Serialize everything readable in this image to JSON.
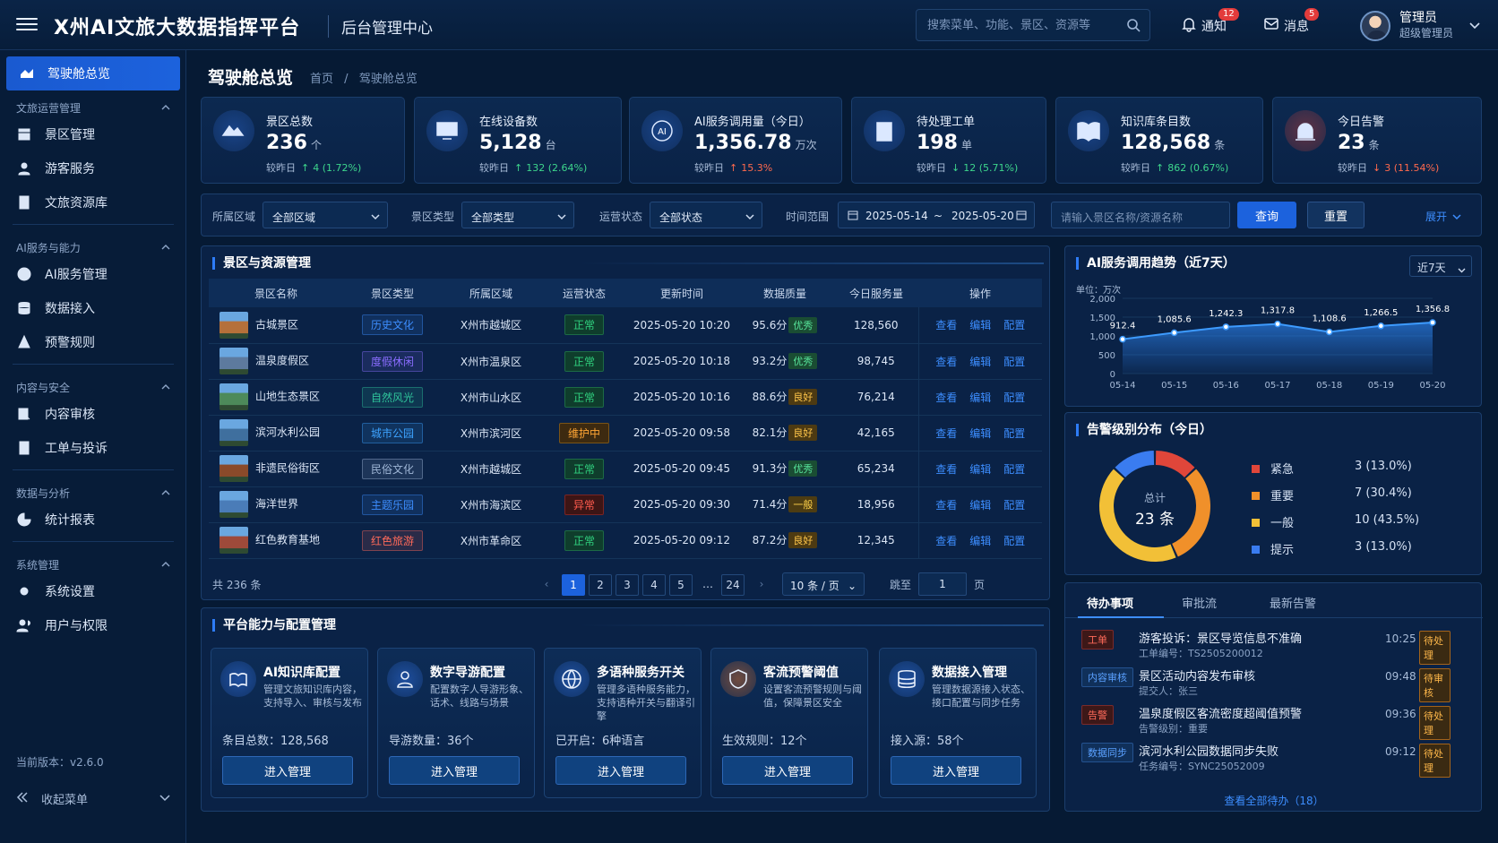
{
  "header": {
    "title": "X州AI文旅大数据指挥平台",
    "subtitle": "后台管理中心",
    "search_placeholder": "搜索菜单、功能、景区、资源等",
    "notify_label": "通知",
    "notify_count": "12",
    "msg_label": "消息",
    "msg_count": "5",
    "user_name": "管理员",
    "user_role": "超级管理员"
  },
  "sidebar": {
    "active": "驾驶舱总览",
    "groups": [
      {
        "title": "文旅运营管理",
        "items": [
          "景区管理",
          "游客服务",
          "文旅资源库"
        ]
      },
      {
        "title": "AI服务与能力",
        "items": [
          "AI服务管理",
          "数据接入",
          "预警规则"
        ]
      },
      {
        "title": "内容与安全",
        "items": [
          "内容审核",
          "工单与投诉"
        ]
      },
      {
        "title": "数据与分析",
        "items": [
          "统计报表"
        ]
      },
      {
        "title": "系统管理",
        "items": [
          "系统设置",
          "用户与权限"
        ]
      }
    ],
    "version": "当前版本：v2.6.0",
    "collapse": "收起菜单"
  },
  "page": {
    "title": "驾驶舱总览",
    "crumb_home": "首页",
    "crumb_sep": "/",
    "crumb_current": "驾驶舱总览"
  },
  "kpis": [
    {
      "label": "景区总数",
      "value": "236",
      "unit": "个",
      "cmp": "较昨日",
      "trend": "up",
      "delta": "4 (1.72%)",
      "color": "#2f6fe0"
    },
    {
      "label": "在线设备数",
      "value": "5,128",
      "unit": "台",
      "cmp": "较昨日",
      "trend": "up",
      "delta": "132 (2.64%)",
      "color": "#2f6fe0"
    },
    {
      "label": "AI服务调用量（今日）",
      "value": "1,356.78",
      "unit": "万次",
      "cmp": "较昨日",
      "trend": "up_red",
      "delta": "15.3%",
      "color": "#2f6fe0"
    },
    {
      "label": "待处理工单",
      "value": "198",
      "unit": "单",
      "cmp": "较昨日",
      "trend": "down",
      "delta": "12 (5.71%)",
      "color": "#2f6fe0"
    },
    {
      "label": "知识库条目数",
      "value": "128,568",
      "unit": "条",
      "cmp": "较昨日",
      "trend": "up",
      "delta": "862 (0.67%)",
      "color": "#2f6fe0"
    },
    {
      "label": "今日告警",
      "value": "23",
      "unit": "条",
      "cmp": "较昨日",
      "trend": "down_red",
      "delta": "3 (11.54%)",
      "color": "#e0463a"
    }
  ],
  "filters": {
    "area_label": "所属区域",
    "area_value": "全部区域",
    "type_label": "景区类型",
    "type_value": "全部类型",
    "status_label": "运营状态",
    "status_value": "全部状态",
    "time_label": "时间范围",
    "date_start": "2025-05-14",
    "date_sep": "~",
    "date_end": "2025-05-20",
    "keyword_placeholder": "请输入景区名称/资源名称",
    "query": "查询",
    "reset": "重置",
    "expand": "展开"
  },
  "table": {
    "title": "景区与资源管理",
    "columns": [
      "景区名称",
      "景区类型",
      "所属区域",
      "运营状态",
      "更新时间",
      "数据质量",
      "今日服务量",
      "操作"
    ],
    "rows": [
      {
        "name": "古城景区",
        "type": "历史文化",
        "tc": "#3d8eff",
        "area": "X州市越城区",
        "status": "正常",
        "sc": "ok",
        "time": "2025-05-20 10:20",
        "score": "95.6分",
        "q": "优秀",
        "qc": "g",
        "service": "128,560",
        "th": "#b5703a"
      },
      {
        "name": "温泉度假区",
        "type": "度假休闲",
        "tc": "#8a6dff",
        "area": "X州市温泉区",
        "status": "正常",
        "sc": "ok",
        "time": "2025-05-20 10:18",
        "score": "93.2分",
        "q": "优秀",
        "qc": "g",
        "service": "98,745",
        "th": "#5d7a9e"
      },
      {
        "name": "山地生态景区",
        "type": "自然风光",
        "tc": "#2fc39a",
        "area": "X州市山水区",
        "status": "正常",
        "sc": "ok",
        "time": "2025-05-20 10:16",
        "score": "88.6分",
        "q": "良好",
        "qc": "y",
        "service": "76,214",
        "th": "#4d8a5a"
      },
      {
        "name": "滨河水利公园",
        "type": "城市公园",
        "tc": "#3da3ff",
        "area": "X州市滨河区",
        "status": "维护中",
        "sc": "mt",
        "time": "2025-05-20 09:58",
        "score": "82.1分",
        "q": "良好",
        "qc": "y",
        "service": "42,165",
        "th": "#3f6f9e"
      },
      {
        "name": "非遗民俗街区",
        "type": "民俗文化",
        "tc": "#9fb6d6",
        "area": "X州市越城区",
        "status": "正常",
        "sc": "ok",
        "time": "2025-05-20 09:45",
        "score": "91.3分",
        "q": "优秀",
        "qc": "g",
        "service": "65,234",
        "th": "#8a4a2a"
      },
      {
        "name": "海洋世界",
        "type": "主题乐园",
        "tc": "#3d8eff",
        "area": "X州市海滨区",
        "status": "异常",
        "sc": "er",
        "time": "2025-05-20 09:30",
        "score": "71.4分",
        "q": "一般",
        "qc": "o",
        "service": "18,956",
        "th": "#4a7cb8"
      },
      {
        "name": "红色教育基地",
        "type": "红色旅游",
        "tc": "#ff6a5a",
        "area": "X州市革命区",
        "status": "正常",
        "sc": "ok",
        "time": "2025-05-20 09:12",
        "score": "87.2分",
        "q": "良好",
        "qc": "y",
        "service": "12,345",
        "th": "#9e4a3a"
      }
    ],
    "ops": [
      "查看",
      "编辑",
      "配置"
    ],
    "total": "共 236 条",
    "pages": [
      "1",
      "2",
      "3",
      "4",
      "5",
      "…",
      "24"
    ],
    "page_size": "10 条 / 页",
    "jump": "跳至",
    "jump_value": "1",
    "page_unit": "页"
  },
  "features": {
    "title": "平台能力与配置管理",
    "items": [
      {
        "title": "AI知识库配置",
        "desc": "管理文旅知识库内容，支持导入、审核与发布",
        "stat": "条目总数：128,568",
        "btn": "进入管理"
      },
      {
        "title": "数字导游配置",
        "desc": "配置数字人导游形象、话术、线路与场景",
        "stat": "导游数量：36个",
        "btn": "进入管理"
      },
      {
        "title": "多语种服务开关",
        "desc": "管理多语种服务能力，支持语种开关与翻译引擎",
        "stat": "已开启：6种语言",
        "btn": "进入管理"
      },
      {
        "title": "客流预警阈值",
        "desc": "设置客流预警规则与阈值，保障景区安全",
        "stat": "生效规则：12个",
        "btn": "进入管理"
      },
      {
        "title": "数据接入管理",
        "desc": "管理数据源接入状态、接口配置与同步任务",
        "stat": "接入源：58个",
        "btn": "进入管理"
      }
    ]
  },
  "trend": {
    "title": "AI服务调用趋势（近7天）",
    "range": "近7天",
    "unit": "单位：万次"
  },
  "chart_data": [
    {
      "type": "area",
      "title": "AI服务调用趋势（近7天）",
      "ylabel": "单位：万次",
      "x": [
        "05-14",
        "05-15",
        "05-16",
        "05-17",
        "05-18",
        "05-19",
        "05-20"
      ],
      "series": [
        {
          "values": [
            912.4,
            1085.6,
            1242.3,
            1317.8,
            1108.6,
            1266.5,
            1356.8
          ]
        }
      ],
      "ylim": [
        0,
        2000
      ],
      "yticks": [
        "0",
        "500",
        "1,000",
        "1,500",
        "2,000"
      ],
      "grid": true
    },
    {
      "type": "pie",
      "title": "告警级别分布（今日）",
      "categories": [
        "紧急",
        "重要",
        "一般",
        "提示"
      ],
      "values": [
        3,
        7,
        10,
        3
      ],
      "colors": [
        "#e0463a",
        "#f0902a",
        "#f2c037",
        "#3a7cf0"
      ],
      "center_label": "总计",
      "center_value": "23 条"
    }
  ],
  "alerts": {
    "title": "告警级别分布（今日）",
    "legend": [
      {
        "name": "紧急",
        "value": "3 (13.0%)"
      },
      {
        "name": "重要",
        "value": "7 (30.4%)"
      },
      {
        "name": "一般",
        "value": "10 (43.5%)"
      },
      {
        "name": "提示",
        "value": "3 (13.0%)"
      }
    ],
    "total_label": "总计",
    "total_value": "23 条"
  },
  "todo": {
    "tabs": [
      "待办事项",
      "审批流",
      "最新告警"
    ],
    "items": [
      {
        "tag": "工单",
        "tc": "r",
        "title": "游客投诉：景区导览信息不准确",
        "sub": "工单编号：TS2505200012",
        "time": "10:25",
        "status": "待处理"
      },
      {
        "tag": "内容审核",
        "tc": "b",
        "title": "景区活动内容发布审核",
        "sub": "提交人：张三",
        "time": "09:48",
        "status": "待审核"
      },
      {
        "tag": "告警",
        "tc": "r",
        "title": "温泉度假区客流密度超阈值预警",
        "sub": "告警级别：重要",
        "time": "09:36",
        "status": "待处理"
      },
      {
        "tag": "数据同步",
        "tc": "b",
        "title": "滨河水利公园数据同步失败",
        "sub": "任务编号：SYNC25052009",
        "time": "09:12",
        "status": "待处理"
      }
    ],
    "view_all": "查看全部待办（18）"
  }
}
